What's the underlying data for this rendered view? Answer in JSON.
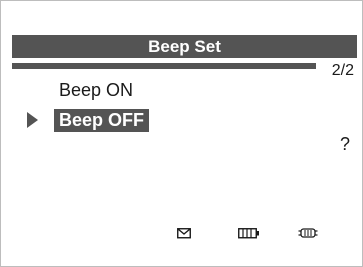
{
  "header": {
    "title": "Beep Set",
    "page_indicator": "2/2",
    "page_progress": 1.0
  },
  "menu": {
    "items": [
      {
        "label": "Beep ON",
        "selected": false
      },
      {
        "label": "Beep OFF",
        "selected": true
      }
    ]
  },
  "help_mark": "?",
  "status_bar": {
    "icons": [
      "mail-icon",
      "battery-icon",
      "vehicle-connection-icon"
    ]
  },
  "colors": {
    "highlight": "#545454",
    "background": "#ffffff",
    "text": "#1a1a1a"
  }
}
